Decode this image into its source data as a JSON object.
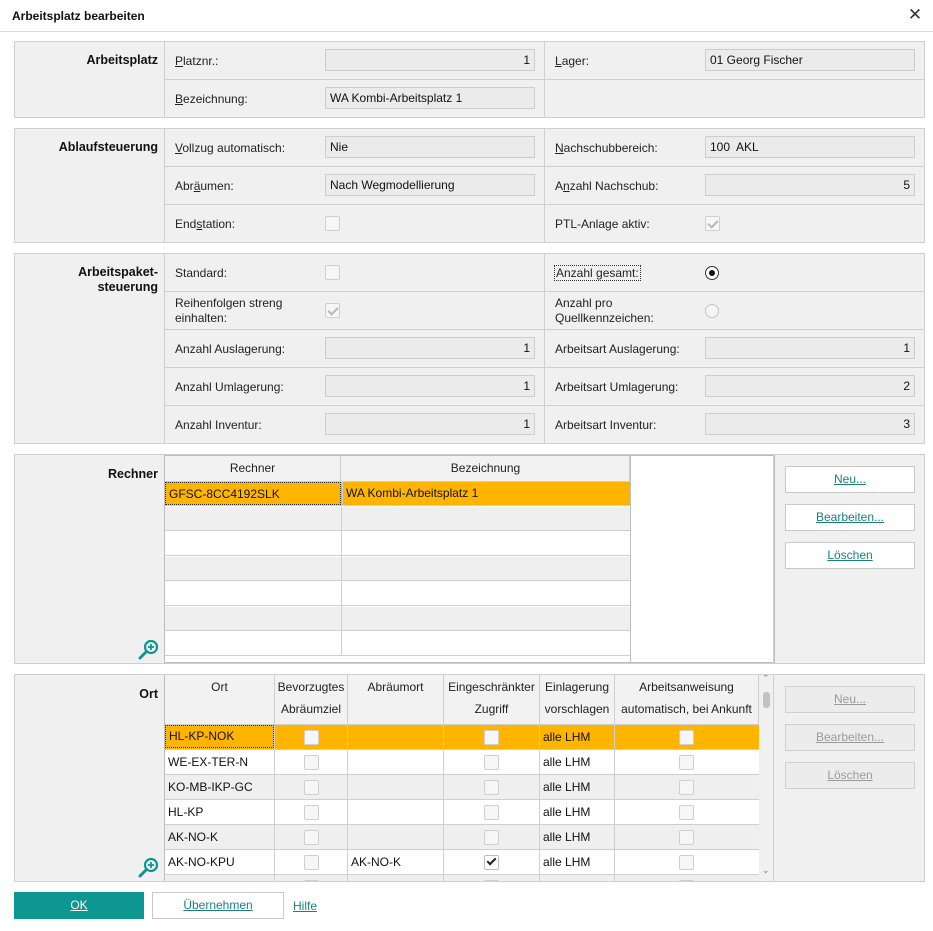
{
  "window": {
    "title": "Arbeitsplatz bearbeiten"
  },
  "arbeitsplatz": {
    "section_label": "Arbeitsplatz",
    "platznr_label": "Platznr.:",
    "platznr_value": "1",
    "lager_label": "Lager:",
    "lager_value": "01 Georg Fischer",
    "bezeichnung_label": "Bezeichnung:",
    "bezeichnung_value": "WA Kombi-Arbeitsplatz 1"
  },
  "ablauf": {
    "section_label": "Ablaufsteuerung",
    "vollzug_label": "Vollzug automatisch:",
    "vollzug_value": "Nie",
    "nachschubbereich_label": "Nachschubbereich:",
    "nachschubbereich_value": "100  AKL",
    "abraeumen_label": "Abräumen:",
    "abraeumen_value": "Nach Wegmodellierung",
    "anzahl_nachschub_label": "Anzahl Nachschub:",
    "anzahl_nachschub_value": "5",
    "endstation_label": "Endstation:",
    "endstation_checked": false,
    "ptl_label": "PTL-Anlage aktiv:",
    "ptl_checked": true
  },
  "paket": {
    "section_label_1": "Arbeitspaket-",
    "section_label_2": "steuerung",
    "standard_label": "Standard:",
    "standard_checked": false,
    "anzahl_gesamt_label": "Anzahl gesamt:",
    "anzahl_gesamt_selected": true,
    "reihenfolgen_label_1": "Reihenfolgen streng",
    "reihenfolgen_label_2": "einhalten:",
    "reihenfolgen_checked": true,
    "anzahl_pro_label_1": "Anzahl pro",
    "anzahl_pro_label_2": "Quellkennzeichen:",
    "anzahl_pro_selected": false,
    "anzahl_auslagerung_label": "Anzahl Auslagerung:",
    "anzahl_auslagerung_value": "1",
    "arbeitsart_auslagerung_label": "Arbeitsart Auslagerung:",
    "arbeitsart_auslagerung_value": "1",
    "anzahl_umlagerung_label": "Anzahl Umlagerung:",
    "anzahl_umlagerung_value": "1",
    "arbeitsart_umlagerung_label": "Arbeitsart Umlagerung:",
    "arbeitsart_umlagerung_value": "2",
    "anzahl_inventur_label": "Anzahl Inventur:",
    "anzahl_inventur_value": "1",
    "arbeitsart_inventur_label": "Arbeitsart Inventur:",
    "arbeitsart_inventur_value": "3"
  },
  "rechner": {
    "section_label": "Rechner",
    "columns": [
      "Rechner",
      "Bezeichnung"
    ],
    "rows": [
      [
        "GFSC-8CC4192SLK",
        "WA Kombi-Arbeitsplatz 1"
      ]
    ],
    "buttons": {
      "neu": "Neu...",
      "bearbeiten": "Bearbeiten...",
      "loeschen": "Löschen"
    }
  },
  "ort": {
    "section_label": "Ort",
    "columns": [
      {
        "l1": "Ort",
        "l2": ""
      },
      {
        "l1": "Bevorzugtes",
        "l2": "Abräumziel"
      },
      {
        "l1": "Abräumort",
        "l2": ""
      },
      {
        "l1": "Eingeschränkter",
        "l2": "Zugriff"
      },
      {
        "l1": "Einlagerung",
        "l2": "vorschlagen"
      },
      {
        "l1": "Arbeitsanweisung",
        "l2": "automatisch, bei Ankunft"
      }
    ],
    "rows": [
      {
        "ort": "HL-KP-NOK",
        "abraeumort": "",
        "zugriff": false,
        "einlagerung": "alle LHM"
      },
      {
        "ort": "WE-EX-TER-N",
        "abraeumort": "",
        "zugriff": false,
        "einlagerung": "alle LHM"
      },
      {
        "ort": "KO-MB-IKP-GC",
        "abraeumort": "",
        "zugriff": false,
        "einlagerung": "alle LHM"
      },
      {
        "ort": "HL-KP",
        "abraeumort": "",
        "zugriff": false,
        "einlagerung": "alle LHM"
      },
      {
        "ort": "AK-NO-K",
        "abraeumort": "",
        "zugriff": false,
        "einlagerung": "alle LHM"
      },
      {
        "ort": "AK-NO-KPU",
        "abraeumort": "AK-NO-K",
        "zugriff": true,
        "einlagerung": "alle LHM"
      }
    ],
    "buttons": {
      "neu": "Neu...",
      "bearbeiten": "Bearbeiten...",
      "loeschen": "Löschen"
    }
  },
  "footer": {
    "ok": "OK",
    "uebernehmen": "Übernehmen",
    "hilfe": "Hilfe"
  },
  "colors": {
    "accent": "#0d9793",
    "selection": "#ffb500",
    "link": "#1a7f7f"
  }
}
